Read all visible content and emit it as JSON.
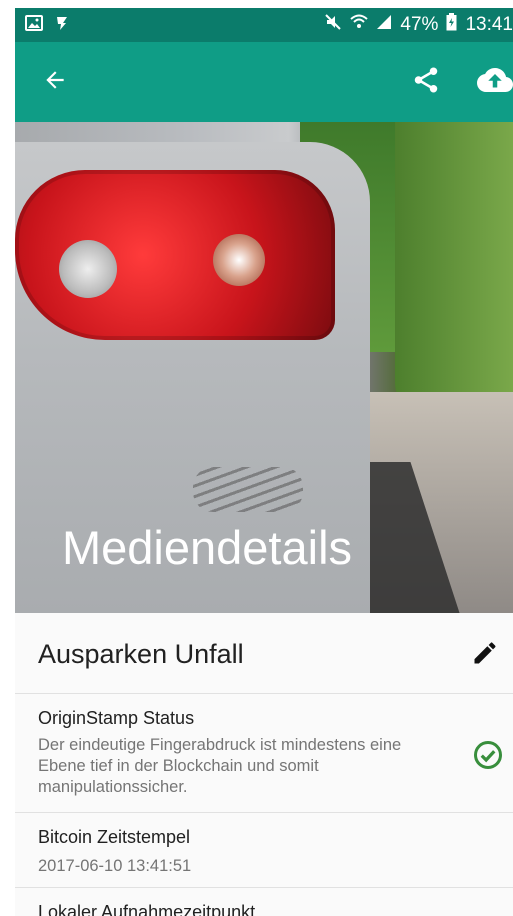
{
  "status_bar": {
    "battery": "47%",
    "time": "13:41",
    "icons": [
      "image-icon",
      "notification-icon",
      "mute-icon",
      "wifi-icon",
      "signal-icon",
      "battery-icon"
    ]
  },
  "app_bar": {
    "icons": [
      "back-arrow-icon",
      "share-icon",
      "cloud-upload-icon"
    ]
  },
  "hero": {
    "title": "Mediendetails"
  },
  "media": {
    "name": "Ausparken Unfall",
    "edit_icon": "pencil-icon"
  },
  "details": [
    {
      "label": "OriginStamp Status",
      "value": "Der eindeutige Fingerabdruck ist mindestens eine Ebene tief in der Blockchain und somit manipulationssicher.",
      "status_icon": "check-circle-icon"
    },
    {
      "label": "Bitcoin Zeitstempel",
      "value": "2017-06-10 13:41:51"
    },
    {
      "label": "Lokaler Aufnahmezeitpunkt"
    }
  ],
  "colors": {
    "primary": "#0f9d86",
    "primary_dark": "#0b7c6b",
    "success": "#388e3c"
  }
}
